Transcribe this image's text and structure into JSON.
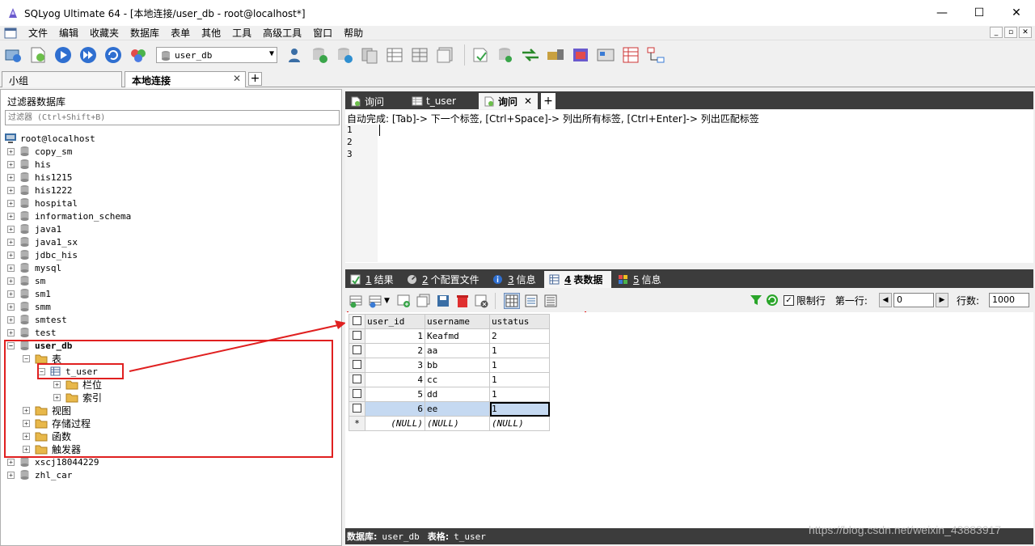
{
  "window": {
    "title": "SQLyog Ultimate 64 - [本地连接/user_db - root@localhost*]",
    "minimize": "—",
    "maximize": "☐",
    "close": "✕"
  },
  "menu": [
    "文件",
    "编辑",
    "收藏夹",
    "数据库",
    "表单",
    "其他",
    "工具",
    "高级工具",
    "窗口",
    "帮助"
  ],
  "toolbar": {
    "database_selected": "user_db"
  },
  "connection_tabs": [
    {
      "label": "小组"
    },
    {
      "label": "本地连接",
      "close": "✕"
    }
  ],
  "add_tab": "+",
  "object_browser": {
    "filter_label": "过滤器数据库",
    "filter_placeholder": "过滤器 (Ctrl+Shift+B)",
    "root": "root@localhost",
    "databases_top": [
      "copy_sm",
      "his",
      "his1215",
      "his1222",
      "hospital",
      "information_schema",
      "java1",
      "java1_sx",
      "jdbc_his",
      "mysql",
      "sm",
      "sm1",
      "smm",
      "smtest",
      "test"
    ],
    "active_db": "user_db",
    "tables_folder": "表",
    "table_name": "t_user",
    "columns_folder": "栏位",
    "indexes_folder": "索引",
    "folders": [
      "视图",
      "存储过程",
      "函数",
      "触发器"
    ],
    "databases_bottom": [
      "xscj18044229",
      "zhl_car"
    ]
  },
  "editor_tabs": [
    {
      "label": "询问"
    },
    {
      "label": "t_user"
    },
    {
      "label": "询问",
      "close": "✕"
    }
  ],
  "editor": {
    "hint": "自动完成: [Tab]-> 下一个标签, [Ctrl+Space]-> 列出所有标签, [Ctrl+Enter]-> 列出匹配标签",
    "line_numbers": [
      "1",
      "2",
      "3"
    ]
  },
  "result_tabs": [
    {
      "num": "1",
      "label": "结果"
    },
    {
      "num": "2",
      "label": "个配置文件"
    },
    {
      "num": "3",
      "label": "信息"
    },
    {
      "num": "4",
      "label": "表数据"
    },
    {
      "num": "5",
      "label": "信息"
    }
  ],
  "limit": {
    "limit_label": "限制行",
    "first_row_label": "第一行:",
    "first_row": "0",
    "rows_label": "行数:",
    "rows": "1000",
    "checked_mark": "✓",
    "prev": "◀",
    "next": "▶"
  },
  "grid": {
    "columns": [
      "user_id",
      "username",
      "ustatus"
    ],
    "rows": [
      [
        "1",
        "Keafmd",
        "2"
      ],
      [
        "2",
        "aa",
        "1"
      ],
      [
        "3",
        "bb",
        "1"
      ],
      [
        "4",
        "cc",
        "1"
      ],
      [
        "5",
        "dd",
        "1"
      ],
      [
        "6",
        "ee",
        "1"
      ]
    ],
    "new_row_marker": "*",
    "null_text": "(NULL)"
  },
  "status": {
    "db_label": "数据库:",
    "db_value": "user_db",
    "table_label": "表格:",
    "table_value": "t_user"
  },
  "watermark": "https://blog.csdn.net/weixin_43883917",
  "colors": {
    "annotation_red": "#e02020",
    "dark_tab_bar": "#3c3c3c",
    "selected_cell": "#c5d9f1"
  }
}
